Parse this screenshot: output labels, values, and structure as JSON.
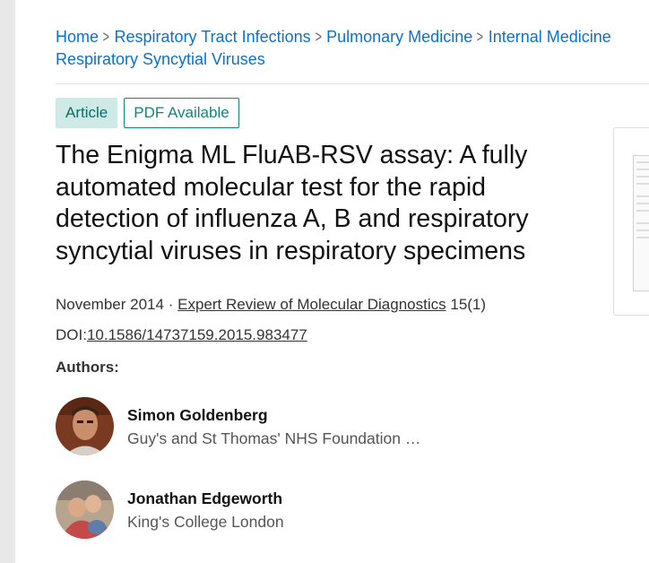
{
  "breadcrumb": {
    "items": [
      "Home",
      "Respiratory Tract Infections",
      "Pulmonary Medicine",
      "Internal Medicine",
      "Respiratory Syncytial Viruses"
    ]
  },
  "badges": {
    "article": "Article",
    "pdf": "PDF Available"
  },
  "title": "The Enigma ML FluAB-RSV assay: A fully automated molecular test for the rapid detection of influenza A, B and respiratory syncytial viruses in respiratory specimens",
  "meta": {
    "date": "November 2014",
    "separator": "·",
    "journal": "Expert Review of Molecular Diagnostics",
    "volume": "15(1)"
  },
  "doi": {
    "label": "DOI:",
    "value": "10.1586/14737159.2015.983477"
  },
  "authors": {
    "heading": "Authors:",
    "list": [
      {
        "name": "Simon Goldenberg",
        "affiliation": "Guy's and St Thomas' NHS Foundation …"
      },
      {
        "name": "Jonathan Edgeworth",
        "affiliation": "King's College London"
      }
    ]
  },
  "colors": {
    "link": "#0b72c9",
    "badge_teal": "#13857c",
    "badge_bg": "#cfe9e6"
  }
}
